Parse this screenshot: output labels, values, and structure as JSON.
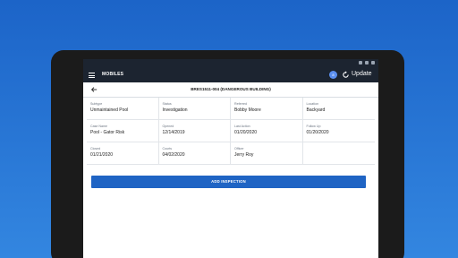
{
  "app": {
    "title": "MOBILES",
    "badge": "8",
    "update_label": "Update"
  },
  "record": {
    "title": "BRES1511-004 (DANGEROUS BUILDING)"
  },
  "fields": [
    {
      "label": "Subtype",
      "value": "Unmaintained Pool"
    },
    {
      "label": "Status",
      "value": "Investigation"
    },
    {
      "label": "Referred",
      "value": "Bobby Moore"
    },
    {
      "label": "Location",
      "value": "Backyard"
    },
    {
      "label": "Case Name",
      "value": "Pool - Gator Risk"
    },
    {
      "label": "Opened",
      "value": "12/14/2019"
    },
    {
      "label": "Last Action",
      "value": "01/20/2020"
    },
    {
      "label": "Follow Up",
      "value": "01/20/2020"
    },
    {
      "label": "Closed",
      "value": "01/21/2020"
    },
    {
      "label": "Courts",
      "value": "04/02/2020"
    },
    {
      "label": "Officer",
      "value": "Jerry Roy"
    },
    {
      "label": "",
      "value": ""
    }
  ],
  "actions": {
    "add_inspection": "ADD INSPECTION"
  },
  "colors": {
    "appbar": "#1c2430",
    "primary_button": "#1f64c4",
    "background": "#2a7ad8"
  },
  "icons": {
    "menu": "menu-icon",
    "sync": "sync-icon",
    "back": "back-arrow-icon"
  }
}
